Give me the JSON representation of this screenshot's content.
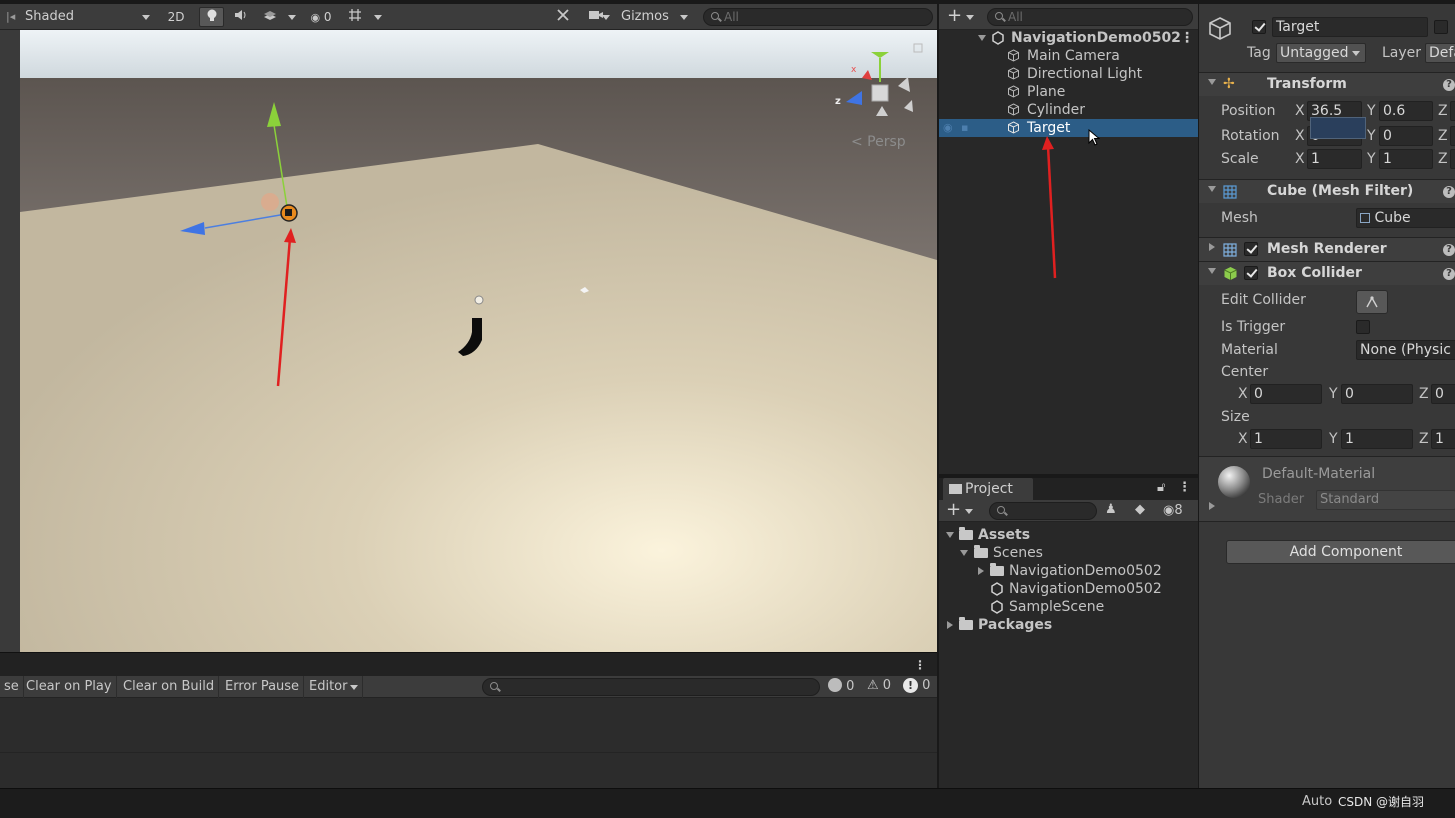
{
  "scene_toolbar": {
    "shading_mode": "Shaded",
    "mode_2d": "2D",
    "hidden_count": "0",
    "gizmos_label": "Gizmos",
    "search_placeholder": "All"
  },
  "viewport": {
    "projection_label": "< Persp",
    "gizmo_axes": [
      "x",
      "z"
    ]
  },
  "console": {
    "buttons": [
      "se",
      "Clear on Play",
      "Clear on Build",
      "Error Pause",
      "Editor"
    ],
    "log_count": "0",
    "warning_count": "0",
    "error_count": "0"
  },
  "hierarchy": {
    "search_placeholder": "All",
    "scene_name": "NavigationDemo0502",
    "items": [
      "Main Camera",
      "Directional Light",
      "Plane",
      "Cylinder",
      "Target"
    ],
    "selected": "Target"
  },
  "project": {
    "tab_label": "Project",
    "hidden_count": "8",
    "tree": [
      {
        "label": "Assets",
        "level": 0,
        "type": "folder-open"
      },
      {
        "label": "Scenes",
        "level": 1,
        "type": "folder-open"
      },
      {
        "label": "NavigationDemo0502",
        "level": 2,
        "type": "folder"
      },
      {
        "label": "NavigationDemo0502",
        "level": 2,
        "type": "scene"
      },
      {
        "label": "SampleScene",
        "level": 2,
        "type": "scene"
      },
      {
        "label": "Packages",
        "level": 0,
        "type": "folder"
      }
    ]
  },
  "inspector": {
    "object_name": "Target",
    "tag_label": "Tag",
    "tag_value": "Untagged",
    "layer_label": "Layer",
    "layer_value": "Defa",
    "transform": {
      "title": "Transform",
      "position_label": "Position",
      "position": {
        "x": "36.5",
        "y": "0.6",
        "z": ""
      },
      "rotation_label": "Rotation",
      "rotation": {
        "x": "0",
        "y": "0",
        "z": ""
      },
      "scale_label": "Scale",
      "scale": {
        "x": "1",
        "y": "1",
        "z": ""
      }
    },
    "mesh_filter": {
      "title": "Cube (Mesh Filter)",
      "mesh_label": "Mesh",
      "mesh_value": "Cube"
    },
    "mesh_renderer": {
      "title": "Mesh Renderer"
    },
    "box_collider": {
      "title": "Box Collider",
      "edit_collider_label": "Edit Collider",
      "is_trigger_label": "Is Trigger",
      "material_label": "Material",
      "material_value": "None (Physic M",
      "center_label": "Center",
      "center": {
        "x": "0",
        "y": "0",
        "z": "0"
      },
      "size_label": "Size",
      "size": {
        "x": "1",
        "y": "1",
        "z": "1"
      }
    },
    "material": {
      "name": "Default-Material",
      "shader_label": "Shader",
      "shader_value": "Standard"
    },
    "add_component_label": "Add Component"
  },
  "status_bar": {
    "auto_label": "Auto",
    "watermark": "CSDN @谢自羽"
  },
  "colors": {
    "selection": "#2c5d87",
    "annotation_arrow": "#e02020",
    "ground": "#cfc3a8",
    "sky": "#dfe6ec"
  }
}
